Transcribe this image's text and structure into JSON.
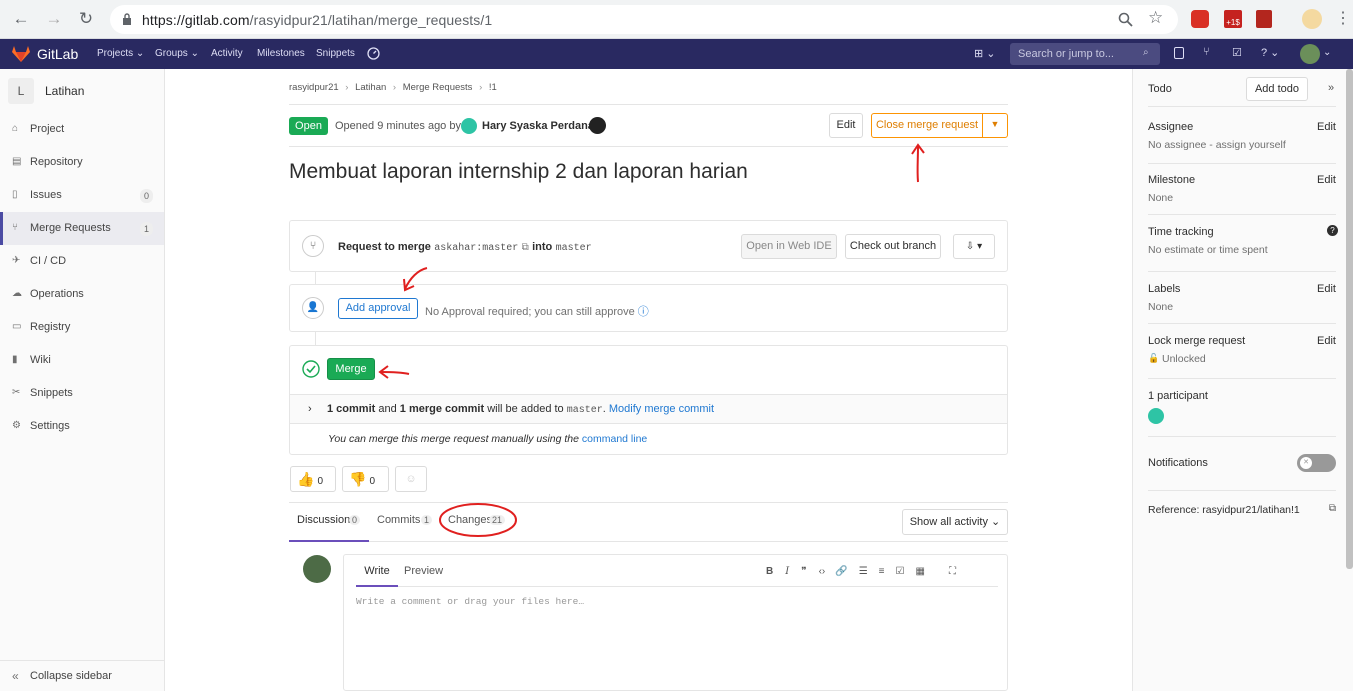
{
  "browser": {
    "url_host": "https://gitlab.com",
    "url_path": "/rasyidpur21/latihan/merge_requests/1"
  },
  "nav": {
    "brand": "GitLab",
    "items": [
      "Projects",
      "Groups",
      "Activity",
      "Milestones",
      "Snippets"
    ],
    "search_placeholder": "Search or jump to..."
  },
  "sidebar": {
    "project_initial": "L",
    "project_name": "Latihan",
    "items": [
      {
        "label": "Project",
        "icon": "home-icon"
      },
      {
        "label": "Repository",
        "icon": "doc-icon"
      },
      {
        "label": "Issues",
        "icon": "issues-icon",
        "count": "0"
      },
      {
        "label": "Merge Requests",
        "icon": "merge-icon",
        "count": "1"
      },
      {
        "label": "CI / CD",
        "icon": "rocket-icon"
      },
      {
        "label": "Operations",
        "icon": "cloud-icon"
      },
      {
        "label": "Registry",
        "icon": "registry-icon"
      },
      {
        "label": "Wiki",
        "icon": "book-icon"
      },
      {
        "label": "Snippets",
        "icon": "scissors-icon"
      },
      {
        "label": "Settings",
        "icon": "gear-icon"
      }
    ],
    "collapse": "Collapse sidebar"
  },
  "breadcrumb": [
    "rasyidpur21",
    "Latihan",
    "Merge Requests",
    "!1"
  ],
  "mr": {
    "status": "Open",
    "opened_text": "Opened 9 minutes ago by",
    "author": "Hary Syaska Perdana",
    "edit": "Edit",
    "close": "Close merge request",
    "title": "Membuat laporan internship 2 dan laporan harian"
  },
  "widget": {
    "request_to_merge": "Request to merge",
    "source": "askahar:master",
    "into": "into",
    "target": "master",
    "open_ide": "Open in Web IDE",
    "checkout": "Check out branch",
    "add_approval": "Add approval",
    "approval_text": "No Approval required; you can still approve",
    "merge": "Merge",
    "commit_count": "1 commit",
    "and": "and",
    "merge_commit": "1 merge commit",
    "will_be_added": "will be added to",
    "branch": "master",
    "modify": "Modify merge commit",
    "manual_text": "You can merge this merge request manually using the",
    "command_line": "command line"
  },
  "reactions": {
    "thumbsup": "0",
    "thumbsdown": "0"
  },
  "tabs": [
    {
      "label": "Discussion",
      "count": "0"
    },
    {
      "label": "Commits",
      "count": "1"
    },
    {
      "label": "Changes",
      "count": "21"
    }
  ],
  "activity": "Show all activity",
  "comment": {
    "write": "Write",
    "preview": "Preview",
    "placeholder": "Write a comment or drag your files here…"
  },
  "right": {
    "todo": "Todo",
    "add_todo": "Add todo",
    "assignee": "Assignee",
    "assignee_val": "No assignee - assign yourself",
    "milestone": "Milestone",
    "milestone_val": "None",
    "time": "Time tracking",
    "time_val": "No estimate or time spent",
    "labels": "Labels",
    "labels_val": "None",
    "lock": "Lock merge request",
    "lock_val": "Unlocked",
    "participants": "1 participant",
    "notifications": "Notifications",
    "reference": "Reference: rasyidpur21/latihan!1",
    "edit": "Edit"
  },
  "colors": {
    "nav": "#292961",
    "green": "#1aaa55",
    "close": "#fc9403",
    "annotation": "#e0201f"
  }
}
